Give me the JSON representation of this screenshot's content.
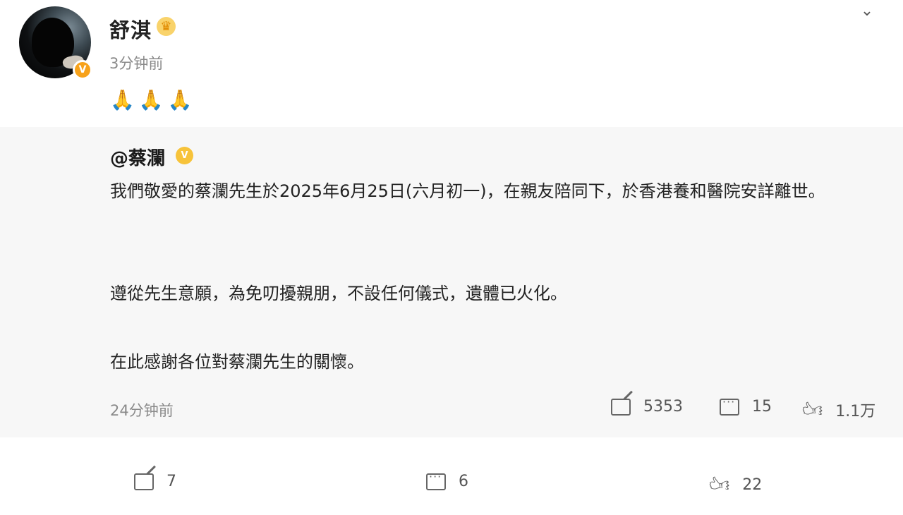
{
  "post": {
    "author": "舒淇",
    "time": "3分钟前",
    "emojis": "🙏🙏🙏"
  },
  "repost": {
    "author": "@蔡瀾",
    "paragraphs": [
      "我們敬愛的蔡瀾先生於2025年6月25日(六月初一)，在親友陪同下，於香港養和醫院安詳離世。",
      "遵從先生意願，為免叨擾親朋，不設任何儀式，遺體已火化。",
      "在此感謝各位對蔡瀾先生的關懷。"
    ],
    "time": "24分钟前",
    "stats": {
      "shares": "5353",
      "comments": "15",
      "likes": "1.1万"
    }
  },
  "actions": {
    "shares": "7",
    "comments": "6",
    "likes": "22"
  },
  "icons": [
    "avatar",
    "verified-badge-icon",
    "crown-icon",
    "chevron-down-icon",
    "share-icon",
    "comment-icon",
    "like-icon"
  ],
  "colors": {
    "badge": "#f7a21b",
    "repost_bg": "#f7f7f7"
  }
}
